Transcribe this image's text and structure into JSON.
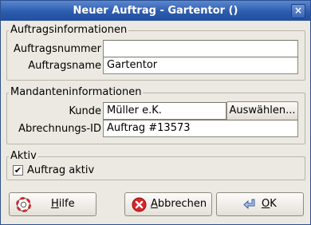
{
  "window": {
    "title": "Neuer Auftrag - Gartentor ()",
    "close_glyph": "×"
  },
  "groups": {
    "auftrag": {
      "title": "Auftragsinformationen",
      "nummer_label": "Auftragsnummer",
      "nummer_value": "",
      "name_label": "Auftragsname",
      "name_value": "Gartentor"
    },
    "mandant": {
      "title": "Mandanteninformationen",
      "kunde_label": "Kunde",
      "kunde_value": "Müller e.K.",
      "auswaehlen_label": "Auswählen...",
      "abrechnung_label": "Abrechnungs-ID",
      "abrechnung_value": "Auftrag #13573"
    },
    "aktiv": {
      "title": "Aktiv",
      "checkbox_label": "Auftrag aktiv",
      "checked_glyph": "✔"
    }
  },
  "buttons": {
    "hilfe": {
      "mnemonic": "H",
      "rest": "ilfe"
    },
    "abbrechen": {
      "mnemonic": "A",
      "rest": "bbrechen"
    },
    "ok": {
      "mnemonic": "O",
      "rest": "K"
    }
  },
  "icons": {
    "help": "help-lifebuoy-icon",
    "cancel": "cancel-x-icon",
    "ok": "ok-arrow-icon"
  },
  "colors": {
    "titlebar": "#2c5cae",
    "window_bg": "#ece9e2",
    "cancel_red": "#d8262b",
    "ok_blue": "#6b8fd0"
  }
}
